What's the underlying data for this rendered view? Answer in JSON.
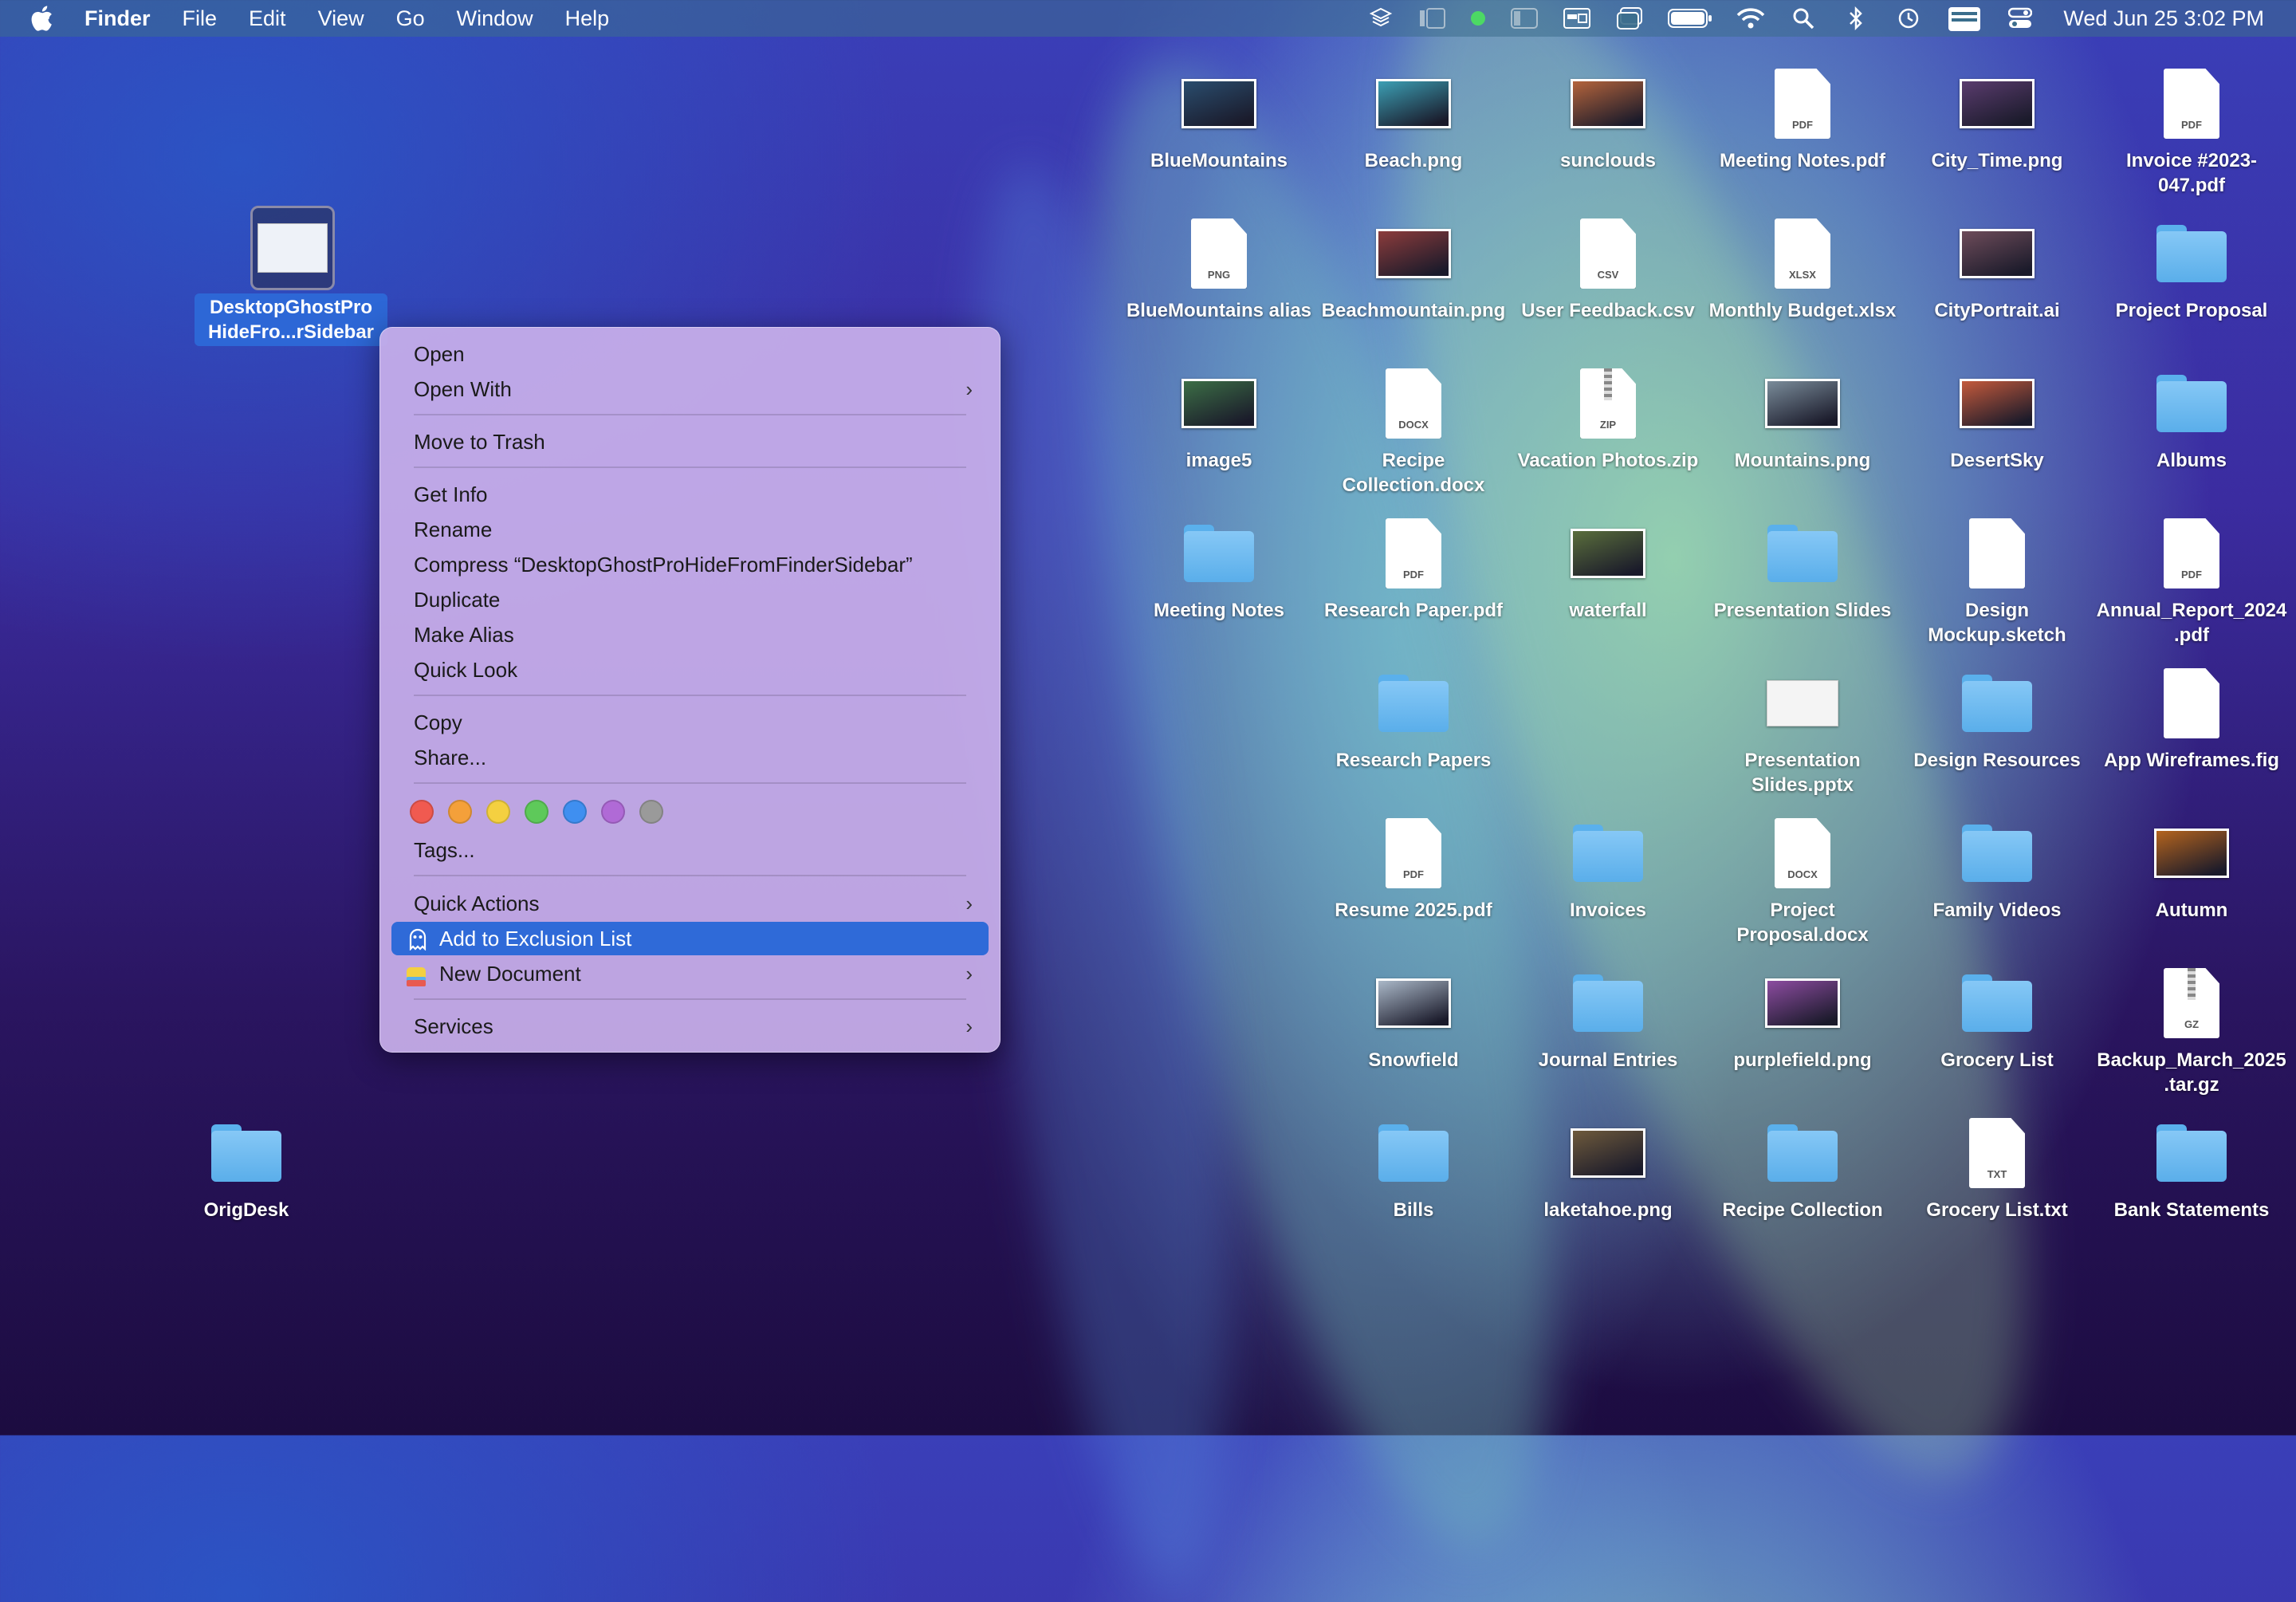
{
  "menubar": {
    "app_name": "Finder",
    "menus": [
      "File",
      "Edit",
      "View",
      "Go",
      "Window",
      "Help"
    ],
    "clock": "Wed Jun 25  3:02 PM",
    "status_icons": [
      "layers-icon",
      "stage-manager-icon",
      "green-dot-icon",
      "sidebar-icon",
      "window-icon",
      "screens-icon",
      "battery-icon",
      "wifi-icon",
      "search-icon",
      "bluetooth-icon",
      "time-machine-icon",
      "finder-drive-icon",
      "control-center-icon"
    ]
  },
  "selected_item": {
    "label": "DesktopGhostPro HideFro...rSidebar"
  },
  "context_menu": {
    "items": {
      "open": "Open",
      "open_with": "Open With",
      "move_to_trash": "Move to Trash",
      "get_info": "Get Info",
      "rename": "Rename",
      "compress": "Compress “DesktopGhostProHideFromFinderSidebar”",
      "duplicate": "Duplicate",
      "make_alias": "Make Alias",
      "quick_look": "Quick Look",
      "copy": "Copy",
      "share": "Share...",
      "tags": "Tags...",
      "quick_actions": "Quick Actions",
      "add_exclusion": "Add to Exclusion List",
      "new_document": "New Document",
      "services": "Services"
    },
    "tag_colors": [
      "#f05a50",
      "#f4a03a",
      "#f4d040",
      "#5ec95a",
      "#3f8ff0",
      "#b06ad6",
      "#9a9a9a"
    ],
    "highlighted": "Add to Exclusion List"
  },
  "desktop_items": [
    {
      "label": "BlueMountains",
      "kind": "image",
      "color": "#2a4d6e"
    },
    {
      "label": "Beach.png",
      "kind": "image",
      "color": "#3c9fb4"
    },
    {
      "label": "sunclouds",
      "kind": "image",
      "color": "#b4643c"
    },
    {
      "label": "Meeting Notes.pdf",
      "kind": "doc",
      "ext": "PDF"
    },
    {
      "label": "City_Time.png",
      "kind": "image",
      "color": "#5a3c6e"
    },
    {
      "label": "Invoice #2023-047.pdf",
      "kind": "doc",
      "ext": "PDF"
    },
    {
      "label": "BlueMountains alias",
      "kind": "doc",
      "ext": "PNG"
    },
    {
      "label": "Beachmountain.png",
      "kind": "image",
      "color": "#8c3c3c"
    },
    {
      "label": "User Feedback.csv",
      "kind": "doc",
      "ext": "CSV"
    },
    {
      "label": "Monthly Budget.xlsx",
      "kind": "doc",
      "ext": "XLSX"
    },
    {
      "label": "CityPortrait.ai",
      "kind": "image",
      "color": "#6e4c5a"
    },
    {
      "label": "Project Proposal",
      "kind": "folder"
    },
    {
      "label": "image5",
      "kind": "image",
      "color": "#3c6e46"
    },
    {
      "label": "Recipe Collection.docx",
      "kind": "doc",
      "ext": "DOCX"
    },
    {
      "label": "Vacation Photos.zip",
      "kind": "zip",
      "ext": "ZIP"
    },
    {
      "label": "Mountains.png",
      "kind": "image",
      "color": "#7a8c9a"
    },
    {
      "label": "DesertSky",
      "kind": "image",
      "color": "#c45a3c"
    },
    {
      "label": "Albums",
      "kind": "folder"
    },
    {
      "label": "Meeting Notes",
      "kind": "folder"
    },
    {
      "label": "Research Paper.pdf",
      "kind": "doc",
      "ext": "PDF"
    },
    {
      "label": "waterfall",
      "kind": "image",
      "color": "#5a6e3c"
    },
    {
      "label": "Presentation Slides",
      "kind": "folder"
    },
    {
      "label": "Design Mockup.sketch",
      "kind": "doc",
      "ext": ""
    },
    {
      "label": "Annual_Report_2024.pdf",
      "kind": "doc",
      "ext": "PDF"
    },
    {
      "label": "Research Papers",
      "kind": "folder"
    },
    {
      "label": "Presentation Slides.pptx",
      "kind": "slide",
      "ext": ""
    },
    {
      "label": "Design Resources",
      "kind": "folder"
    },
    {
      "label": "App Wireframes.fig",
      "kind": "doc",
      "ext": ""
    },
    {
      "label": "Resume 2025.pdf",
      "kind": "doc",
      "ext": "PDF"
    },
    {
      "label": "Invoices",
      "kind": "folder"
    },
    {
      "label": "Project Proposal.docx",
      "kind": "doc",
      "ext": "DOCX"
    },
    {
      "label": "Family Videos",
      "kind": "folder"
    },
    {
      "label": "Autumn",
      "kind": "image",
      "color": "#b4641e"
    },
    {
      "label": "Snowfield",
      "kind": "image",
      "color": "#aab8c8"
    },
    {
      "label": "Journal Entries",
      "kind": "folder"
    },
    {
      "label": "purplefield.png",
      "kind": "image",
      "color": "#8c4ca0"
    },
    {
      "label": "Grocery List",
      "kind": "folder"
    },
    {
      "label": "Backup_March_2025.tar.gz",
      "kind": "zip",
      "ext": "GZ"
    },
    {
      "label": "Bills",
      "kind": "folder"
    },
    {
      "label": "laketahoe.png",
      "kind": "image",
      "color": "#6e5a3c"
    },
    {
      "label": "Recipe Collection",
      "kind": "folder"
    },
    {
      "label": "Grocery List.txt",
      "kind": "doc",
      "ext": "TXT"
    },
    {
      "label": "Bank Statements",
      "kind": "folder"
    },
    {
      "label": "OrigDesk",
      "kind": "folder"
    }
  ]
}
